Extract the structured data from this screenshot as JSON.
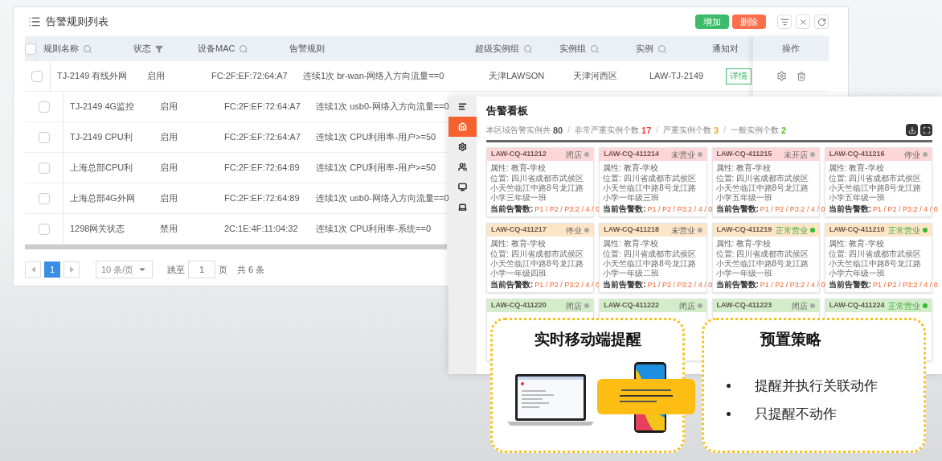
{
  "rule_list": {
    "title": "告警规则列表",
    "toolbar_buttons": [
      {
        "label": "增加",
        "kind": "add"
      },
      {
        "label": "删除",
        "kind": "delete"
      }
    ],
    "tool_icons": [
      {
        "kind": "filter"
      },
      {
        "kind": "close"
      },
      {
        "kind": "refresh"
      }
    ],
    "header_checkbox": {
      "checked": false
    },
    "columns": [
      {
        "label": "规则名称",
        "kind": "search"
      },
      {
        "label": "状态",
        "kind": "filter"
      },
      {
        "label": "设备MAC",
        "kind": "search"
      },
      {
        "label": "告警规则",
        "kind": "plain"
      },
      {
        "label": "超级实例组",
        "kind": "search"
      },
      {
        "label": "实例组",
        "kind": "search"
      },
      {
        "label": "实例",
        "kind": "search"
      },
      {
        "label": "通知对",
        "kind": "plain"
      }
    ],
    "actions_header": "操作",
    "rows": [
      {
        "checked": false,
        "cells": [
          "TJ-2149 有线外网",
          "启用",
          "FC:2F:EF:72:64:A7",
          "连续1次 br-wan-网络入方向流量==0",
          "天津LAWSON",
          "天津河西区",
          "LAW-TJ-2149"
        ],
        "detail": "详情",
        "actions": true
      },
      {
        "checked": false,
        "cells": [
          "TJ-2149 4G监控",
          "启用",
          "FC:2F:EF:72:64:A7",
          "连续1次 usb0-网络入方向流量==0"
        ]
      },
      {
        "checked": false,
        "cells": [
          "TJ-2149 CPU利",
          "启用",
          "FC:2F:EF:72:64:A7",
          "连续1次 CPU利用率-用户>=50"
        ]
      },
      {
        "checked": false,
        "cells": [
          "上海总部CPU利",
          "启用",
          "FC:2F:EF:72:64:89",
          "连续1次 CPU利用率-用户>=50"
        ]
      },
      {
        "checked": false,
        "cells": [
          "上海总部4G外网",
          "启用",
          "FC:2F:EF:72:64:89",
          "连续1次 usb0-网络入方向流量==0"
        ]
      },
      {
        "checked": false,
        "cells": [
          "1298网关状态",
          "禁用",
          "2C:1E:4F:11:04:32",
          "连续1次 CPU利用率-系统==0"
        ]
      }
    ],
    "pagination": {
      "pages": [
        {
          "label": "1",
          "selected": true
        }
      ],
      "page_size": "10 条/页",
      "goto_label": "跳至",
      "goto_value": "1",
      "page_unit": "页",
      "total": "共 6 条"
    }
  },
  "dashboard": {
    "title": "告警看板",
    "nav": [
      {
        "kind": "menu",
        "selected": false
      },
      {
        "kind": "home",
        "selected": true
      },
      {
        "kind": "settings",
        "selected": false
      },
      {
        "kind": "group",
        "selected": false
      },
      {
        "kind": "monitor",
        "selected": false
      },
      {
        "kind": "laptop",
        "selected": false
      }
    ],
    "stats": [
      {
        "label": "本区域告警实例共",
        "value": "80",
        "color": "#555555"
      },
      {
        "separator": "/",
        "label": "非常严重实例个数",
        "value": "17",
        "color": "#e8403a"
      },
      {
        "separator": "/",
        "label": "严重实例个数",
        "value": "3",
        "color": "#f5a623"
      },
      {
        "separator": "/",
        "label": "一般实例个数",
        "value": "2",
        "color": "#52c41a"
      }
    ],
    "cards": [
      {
        "id": "LAW-CQ-411212",
        "color": "#fdd7d7",
        "status": "闭店",
        "open": false,
        "attribute_label": "属性:",
        "attribute": "教育-学校",
        "location_label": "位置:",
        "location": "四川省成都市武侯区小天竺临江中路8号龙江路小学三年级一班",
        "alarm_label": "当前告警数:",
        "alarms": "P1 / P2 / P3:2 / 4 / 0"
      },
      {
        "id": "LAW-CQ-411214",
        "color": "#fdd7d7",
        "status": "未营业",
        "open": false,
        "attribute_label": "属性:",
        "attribute": "教育-学校",
        "location_label": "位置:",
        "location": "四川省成都市武侯区小天竺临江中路8号龙江路小学一年级三班",
        "alarm_label": "当前告警数:",
        "alarms": "P1 / P2 / P3:2 / 4 / 0"
      },
      {
        "id": "LAW-CQ-411215",
        "color": "#fdd7d7",
        "status": "未开店",
        "open": false,
        "attribute_label": "属性:",
        "attribute": "教育-学校",
        "location_label": "位置:",
        "location": "四川省成都市武侯区小天竺临江中路8号龙江路小学五年级一班",
        "alarm_label": "当前告警数:",
        "alarms": "P1 / P2 / P3:2 / 4 / 0"
      },
      {
        "id": "LAW-CQ-411216",
        "color": "#fdd7d7",
        "status": "停业",
        "open": false,
        "attribute_label": "属性:",
        "attribute": "教育-学校",
        "location_label": "位置:",
        "location": "四川省成都市武侯区小天竺临江中路8号龙江路小学五年级一班",
        "alarm_label": "当前告警数:",
        "alarms": "P1 / P2 / P3:2 / 4 / 0"
      },
      {
        "id": "LAW-CQ-411217",
        "color": "#fde6c8",
        "status": "停业",
        "open": false,
        "attribute_label": "属性:",
        "attribute": "教育-学校",
        "location_label": "位置:",
        "location": "四川省成都市武侯区小天竺临江中路8号龙江路小学一年级四班",
        "alarm_label": "当前告警数:",
        "alarms": "P1 / P2 / P3:2 / 4 / 0"
      },
      {
        "id": "LAW-CQ-411218",
        "color": "#fde6c8",
        "status": "未营业",
        "open": false,
        "attribute_label": "属性:",
        "attribute": "教育-学校",
        "location_label": "位置:",
        "location": "四川省成都市武侯区小天竺临江中路8号龙江路小学一年级二班",
        "alarm_label": "当前告警数:",
        "alarms": "P1 / P2 / P3:2 / 4 / 0"
      },
      {
        "id": "LAW-CQ-411219",
        "color": "#fde6c8",
        "status": "正常营业",
        "open": true,
        "attribute_label": "属性:",
        "attribute": "教育-学校",
        "location_label": "位置:",
        "location": "四川省成都市武侯区小天竺临江中路8号龙江路小学一年级一班",
        "alarm_label": "当前告警数:",
        "alarms": "P1 / P2 / P3:2 / 4 / 0"
      },
      {
        "id": "LAW-CQ-411210",
        "color": "#fde6c8",
        "status": "正常营业",
        "open": true,
        "attribute_label": "属性:",
        "attribute": "教育-学校",
        "location_label": "位置:",
        "location": "四川省成都市武侯区小天竺临江中路8号龙江路小学六年级一班",
        "alarm_label": "当前告警数:",
        "alarms": "P1 / P2 / P3:2 / 4 / 0"
      },
      {
        "id": "LAW-CQ-411220",
        "color": "#d3ecc9",
        "status": "闭店",
        "open": false
      },
      {
        "id": "LAW-CQ-411222",
        "color": "#d3ecc9",
        "status": "闭店",
        "open": false
      },
      {
        "id": "LAW-CQ-411223",
        "color": "#d3ecc9",
        "status": "闭店",
        "open": false
      },
      {
        "id": "LAW-CQ-411224",
        "color": "#d3ecc9",
        "status": "正常营业",
        "open": true
      }
    ]
  },
  "callouts": [
    {
      "kind": "mobile",
      "title": "实时移动端提醒"
    },
    {
      "kind": "bullets",
      "title": "预置策略",
      "items": [
        "提醒并执行关联动作",
        "只提醒不动作"
      ]
    }
  ]
}
